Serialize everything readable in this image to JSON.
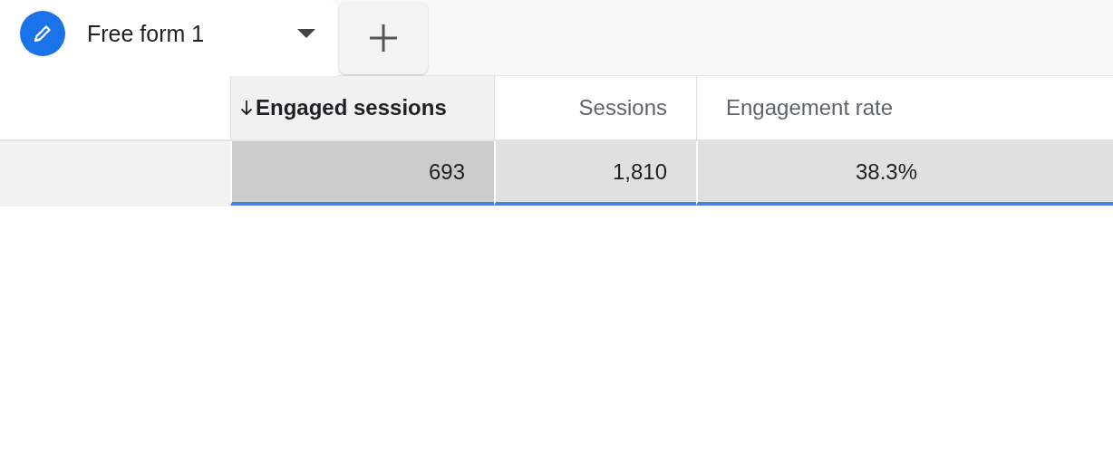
{
  "tabs": [
    {
      "label": "Free form 1",
      "selected": true
    }
  ],
  "table": {
    "columns": [
      {
        "label": "Engaged sessions",
        "sorted": true
      },
      {
        "label": "Sessions",
        "sorted": false
      },
      {
        "label": "Engagement rate",
        "sorted": false
      }
    ],
    "rows": [
      {
        "cells": [
          "693",
          "1,810",
          "38.3%"
        ]
      }
    ]
  }
}
